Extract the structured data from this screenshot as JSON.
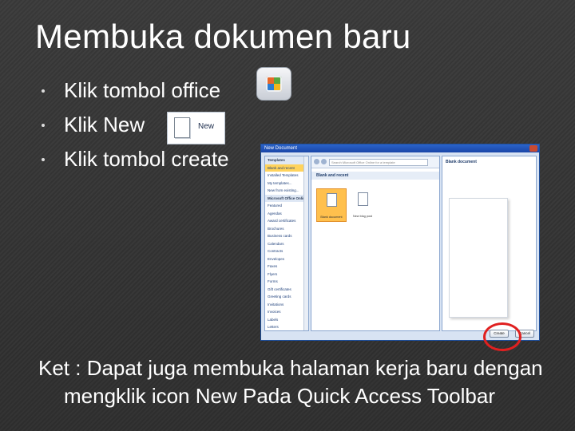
{
  "slide": {
    "title": "Membuka dokumen baru",
    "bullets": [
      "Klik tombol office",
      "Klik New",
      "Klik tombol create"
    ],
    "note": "Ket : Dapat juga membuka halaman kerja baru dengan mengklik icon New Pada Quick Access Toolbar"
  },
  "new_button": {
    "label": "New"
  },
  "dialog": {
    "title": "New Document",
    "left_items": [
      {
        "label": "Templates",
        "kind": "hdr"
      },
      {
        "label": "Blank and recent",
        "kind": "sel"
      },
      {
        "label": "Installed Templates",
        "kind": ""
      },
      {
        "label": "My templates...",
        "kind": ""
      },
      {
        "label": "New from existing...",
        "kind": ""
      },
      {
        "label": "Microsoft Office Online",
        "kind": "hdr"
      },
      {
        "label": "Featured",
        "kind": ""
      },
      {
        "label": "Agendas",
        "kind": ""
      },
      {
        "label": "Award certificates",
        "kind": ""
      },
      {
        "label": "Brochures",
        "kind": ""
      },
      {
        "label": "Business cards",
        "kind": ""
      },
      {
        "label": "Calendars",
        "kind": ""
      },
      {
        "label": "Contracts",
        "kind": ""
      },
      {
        "label": "Envelopes",
        "kind": ""
      },
      {
        "label": "Faxes",
        "kind": ""
      },
      {
        "label": "Flyers",
        "kind": ""
      },
      {
        "label": "Forms",
        "kind": ""
      },
      {
        "label": "Gift certificates",
        "kind": ""
      },
      {
        "label": "Greeting cards",
        "kind": ""
      },
      {
        "label": "Invitations",
        "kind": ""
      },
      {
        "label": "Invoices",
        "kind": ""
      },
      {
        "label": "Labels",
        "kind": ""
      },
      {
        "label": "Letters",
        "kind": ""
      }
    ],
    "search_placeholder": "Search Microsoft Office Online for a template",
    "section_title": "Blank and recent",
    "thumbs": [
      "Blank document",
      "New blog post"
    ],
    "preview_title": "Blank document",
    "create_label": "Create",
    "cancel_label": "Cancel"
  }
}
